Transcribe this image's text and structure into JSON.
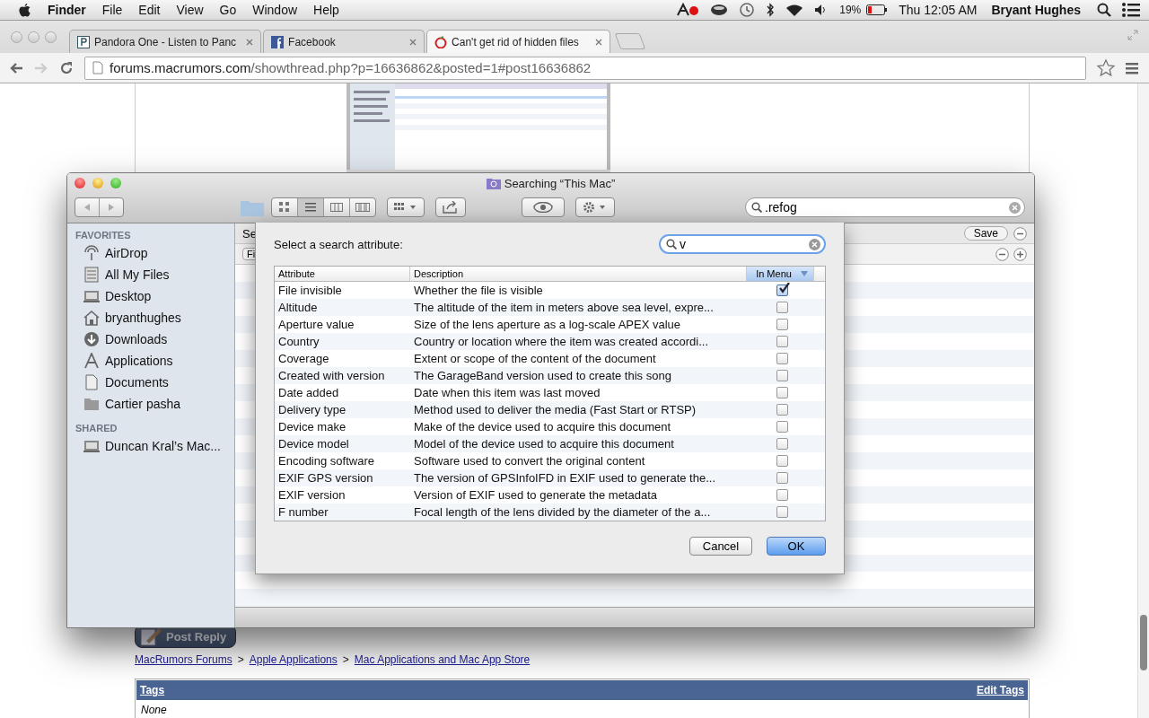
{
  "menubar": {
    "app": "Finder",
    "menus": [
      "File",
      "Edit",
      "View",
      "Go",
      "Window",
      "Help"
    ],
    "battery": "19%",
    "clock": "Thu 12:05 AM",
    "user": "Bryant Hughes"
  },
  "browser": {
    "tabs": [
      {
        "title": "Pandora One - Listen to Panc",
        "selected": false
      },
      {
        "title": "Facebook",
        "selected": false
      },
      {
        "title": "Can't get rid of hidden files",
        "selected": true
      }
    ],
    "url_host": "forums.macrumors.com",
    "url_path": "/showthread.php?p=16636862&posted=1#post16636862"
  },
  "page": {
    "post_reply": "Post Reply",
    "breadcrumbs": [
      "MacRumors Forums",
      "Apple Applications",
      "Mac Applications and Mac App Store"
    ],
    "breadcrumb_separator": ">",
    "tags_title": "Tags",
    "edit_tags": "Edit Tags",
    "tags_value": "None"
  },
  "finder": {
    "title": "Searching “This Mac”",
    "search_value": ".refog",
    "scope_label": "Se",
    "filter_label": "Fi",
    "save": "Save",
    "sidebar": [
      {
        "heading": "FAVORITES",
        "items": [
          "AirDrop",
          "All My Files",
          "Desktop",
          "bryanthughes",
          "Downloads",
          "Applications",
          "Documents",
          "Cartier pasha"
        ]
      },
      {
        "heading": "SHARED",
        "items": [
          "Duncan Kral’s Mac..."
        ]
      }
    ]
  },
  "dialog": {
    "prompt": "Select a search attribute:",
    "search_value": "v",
    "columns": [
      "Attribute",
      "Description",
      "In Menu"
    ],
    "rows": [
      {
        "attribute": "File invisible",
        "description": "Whether the file is visible",
        "checked": true
      },
      {
        "attribute": "Altitude",
        "description": "The altitude of the item in meters above sea level, expre...",
        "checked": false
      },
      {
        "attribute": "Aperture value",
        "description": "Size of the lens aperture as a log-scale APEX value",
        "checked": false
      },
      {
        "attribute": "Country",
        "description": "Country or location where the item was created accordi...",
        "checked": false
      },
      {
        "attribute": "Coverage",
        "description": "Extent or scope of the content of the document",
        "checked": false
      },
      {
        "attribute": "Created with version",
        "description": "The GarageBand version used to create this song",
        "checked": false
      },
      {
        "attribute": "Date added",
        "description": "Date when this item was last moved",
        "checked": false
      },
      {
        "attribute": "Delivery type",
        "description": "Method used to deliver the media (Fast Start or RTSP)",
        "checked": false
      },
      {
        "attribute": "Device make",
        "description": "Make of the device used to acquire this document",
        "checked": false
      },
      {
        "attribute": "Device model",
        "description": "Model of the device used to acquire this document",
        "checked": false
      },
      {
        "attribute": "Encoding software",
        "description": "Software used to convert the original content",
        "checked": false
      },
      {
        "attribute": "EXIF GPS version",
        "description": "The version of GPSInfoIFD in EXIF used to generate the...",
        "checked": false
      },
      {
        "attribute": "EXIF version",
        "description": "Version of EXIF used to generate the metadata",
        "checked": false
      },
      {
        "attribute": "F number",
        "description": "Focal length of the lens divided by the diameter of the a...",
        "checked": false
      }
    ],
    "cancel": "Cancel",
    "ok": "OK"
  }
}
